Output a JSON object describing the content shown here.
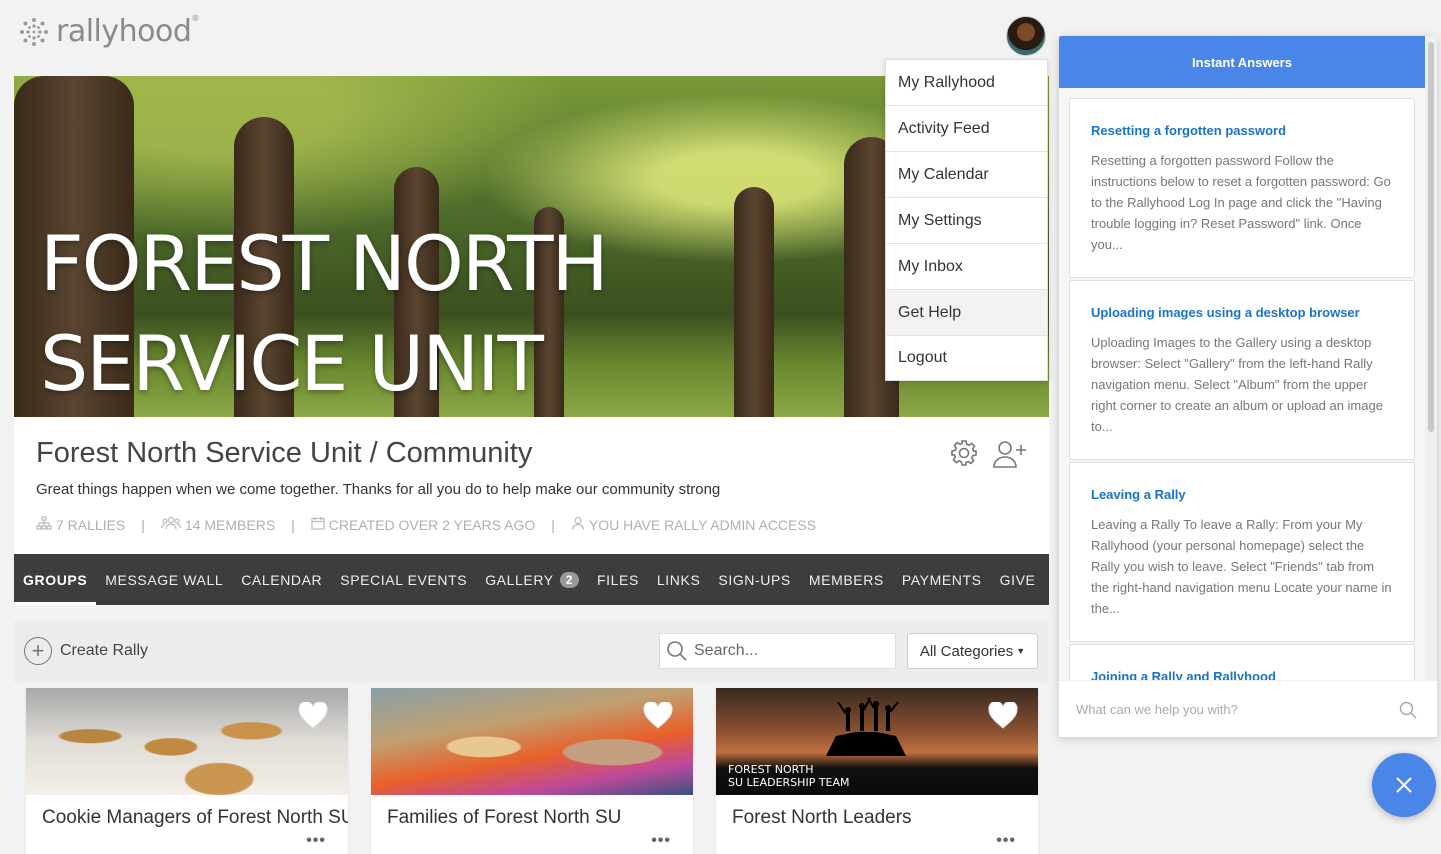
{
  "brand": {
    "name": "rallyhood",
    "trademark": "®"
  },
  "hero": {
    "line1": "FOREST NORTH",
    "line2": "SERVICE UNIT"
  },
  "info": {
    "title": "Forest North Service Unit / Community",
    "description": "Great things happen when we come together. Thanks for all you do to help make our community strong",
    "rallies": "7 RALLIES",
    "members": "14 MEMBERS",
    "created": "CREATED OVER 2 YEARS AGO",
    "access": "YOU HAVE RALLY ADMIN ACCESS",
    "separator": "|"
  },
  "nav": {
    "tabs": [
      "GROUPS",
      "MESSAGE WALL",
      "CALENDAR",
      "SPECIAL EVENTS",
      "GALLERY",
      "FILES",
      "LINKS",
      "SIGN-UPS",
      "MEMBERS",
      "PAYMENTS",
      "GIVE"
    ],
    "gallery_badge": "2",
    "active": "GROUPS"
  },
  "toolbar": {
    "create_label": "Create Rally",
    "search_placeholder": "Search...",
    "category_label": "All Categories"
  },
  "cards": [
    {
      "name": "Cookie Managers of Forest North SU",
      "dots": "•••"
    },
    {
      "name": "Families of Forest North SU",
      "dots": "•••"
    },
    {
      "name": "Forest North Leaders",
      "dots": "•••",
      "overlay_line1": "FOREST NORTH",
      "overlay_line2": "SU LEADERSHIP TEAM"
    }
  ],
  "menu": {
    "items": [
      "My Rallyhood",
      "Activity Feed",
      "My Calendar",
      "My Settings",
      "My Inbox",
      "Get Help",
      "Logout"
    ],
    "hovered": "Get Help"
  },
  "help": {
    "header": "Instant Answers",
    "articles": [
      {
        "title": "Resetting a forgotten password",
        "body": "Resetting a forgotten password Follow the instructions below to reset a forgotten password: Go to the Rallyhood Log In page and click the \"Having trouble logging in? Reset Password\" link. Once you..."
      },
      {
        "title": "Uploading images using a desktop browser",
        "body": "Uploading Images to the Gallery using a desktop browser: Select \"Gallery\" from the left-hand Rally navigation menu. Select \"Album\" from the upper right corner to create an album or upload an image to..."
      },
      {
        "title": "Leaving a Rally",
        "body": "Leaving a Rally To leave a Rally: From your My Rallyhood (your personal homepage) select the Rally you wish to leave. Select \"Friends\" tab from the right-hand navigation menu Locate your name in the..."
      },
      {
        "title": "Joining a Rally and Rallyhood",
        "body": ""
      }
    ],
    "input_placeholder": "What can we help you with?"
  },
  "colors": {
    "accent": "#4a86e8",
    "nav_bg": "#3d3d3d",
    "link": "#1a73c7"
  }
}
